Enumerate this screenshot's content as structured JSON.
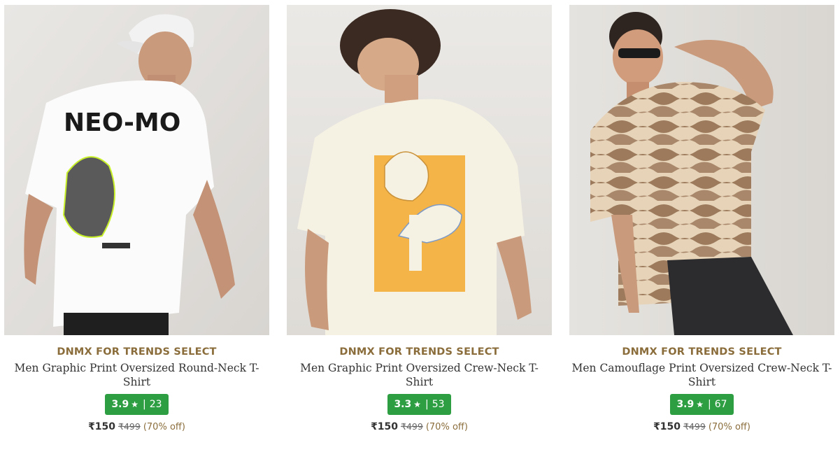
{
  "products": [
    {
      "brand": "DNMX FOR TRENDS SELECT",
      "name": "Men Graphic Print Oversized Round-Neck T-Shirt",
      "rating": "3.9",
      "reviews": "23",
      "price": "₹150",
      "mrp": "₹499",
      "discount": "(70% off)",
      "image_text": "NEO-MO"
    },
    {
      "brand": "DNMX FOR TRENDS SELECT",
      "name": "Men Graphic Print Oversized Crew-Neck T-Shirt",
      "rating": "3.3",
      "reviews": "53",
      "price": "₹150",
      "mrp": "₹499",
      "discount": "(70% off)"
    },
    {
      "brand": "DNMX FOR TRENDS SELECT",
      "name": "Men Camouflage Print Oversized Crew-Neck T-Shirt",
      "rating": "3.9",
      "reviews": "67",
      "price": "₹150",
      "mrp": "₹499",
      "discount": "(70% off)"
    }
  ],
  "rating_separator": "|",
  "star_icon": "star-icon",
  "colors": {
    "brand": "#8a6d3b",
    "rating_bg": "#2e9e43",
    "name": "#333333",
    "discount": "#8a6d3b"
  }
}
